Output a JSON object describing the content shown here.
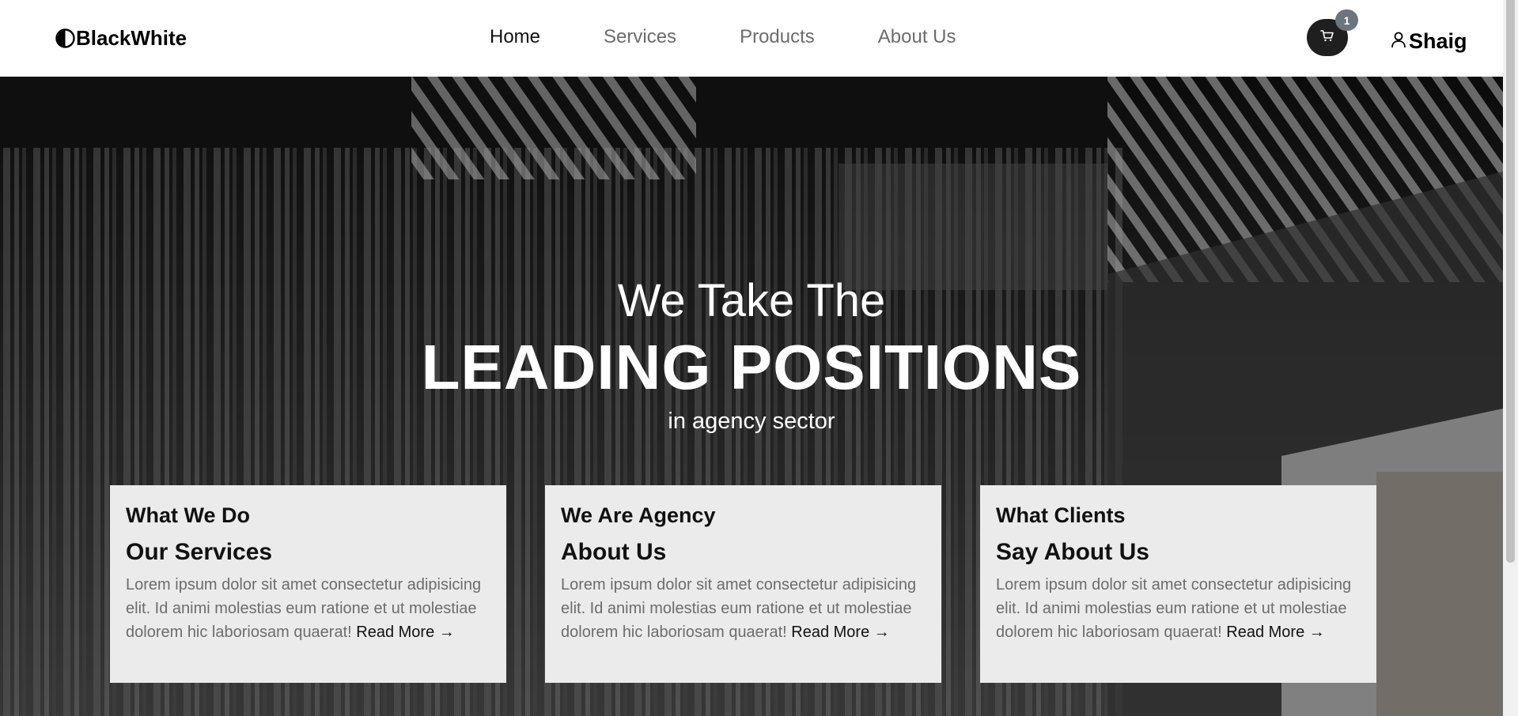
{
  "brand": {
    "name": "BlackWhite",
    "icon": "half-circle-icon"
  },
  "nav": {
    "items": [
      {
        "label": "Home",
        "active": true
      },
      {
        "label": "Services",
        "active": false
      },
      {
        "label": "Products",
        "active": false
      },
      {
        "label": "About Us",
        "active": false
      }
    ]
  },
  "cart": {
    "icon": "cart-icon",
    "count": "1"
  },
  "user": {
    "icon": "user-icon",
    "name": "Shaig"
  },
  "hero": {
    "line1": "We Take The",
    "line2": "LEADING POSITIONS",
    "line3": "in agency sector"
  },
  "cards": [
    {
      "kicker": "What We Do",
      "title": "Our Services",
      "text": "Lorem ipsum dolor sit amet consectetur adipisicing elit. Id animi molestias eum ratione et ut molestiae dolorem hic laboriosam quaerat!",
      "link": "Read More →"
    },
    {
      "kicker": "We Are Agency",
      "title": "About Us",
      "text": "Lorem ipsum dolor sit amet consectetur adipisicing elit. Id animi molestias eum ratione et ut molestiae dolorem hic laboriosam quaerat!",
      "link": "Read More →"
    },
    {
      "kicker": "What Clients",
      "title": "Say About Us",
      "text": "Lorem ipsum dolor sit amet consectetur adipisicing elit. Id animi molestias eum ratione et ut molestiae dolorem hic laboriosam quaerat!",
      "link": "Read More →"
    }
  ],
  "colors": {
    "header_bg": "#ffffff",
    "cart_bg": "#1f1f1f",
    "badge_bg": "#6c757d",
    "card_bg": "#ebebeb",
    "muted_text": "#6c6c6c"
  }
}
